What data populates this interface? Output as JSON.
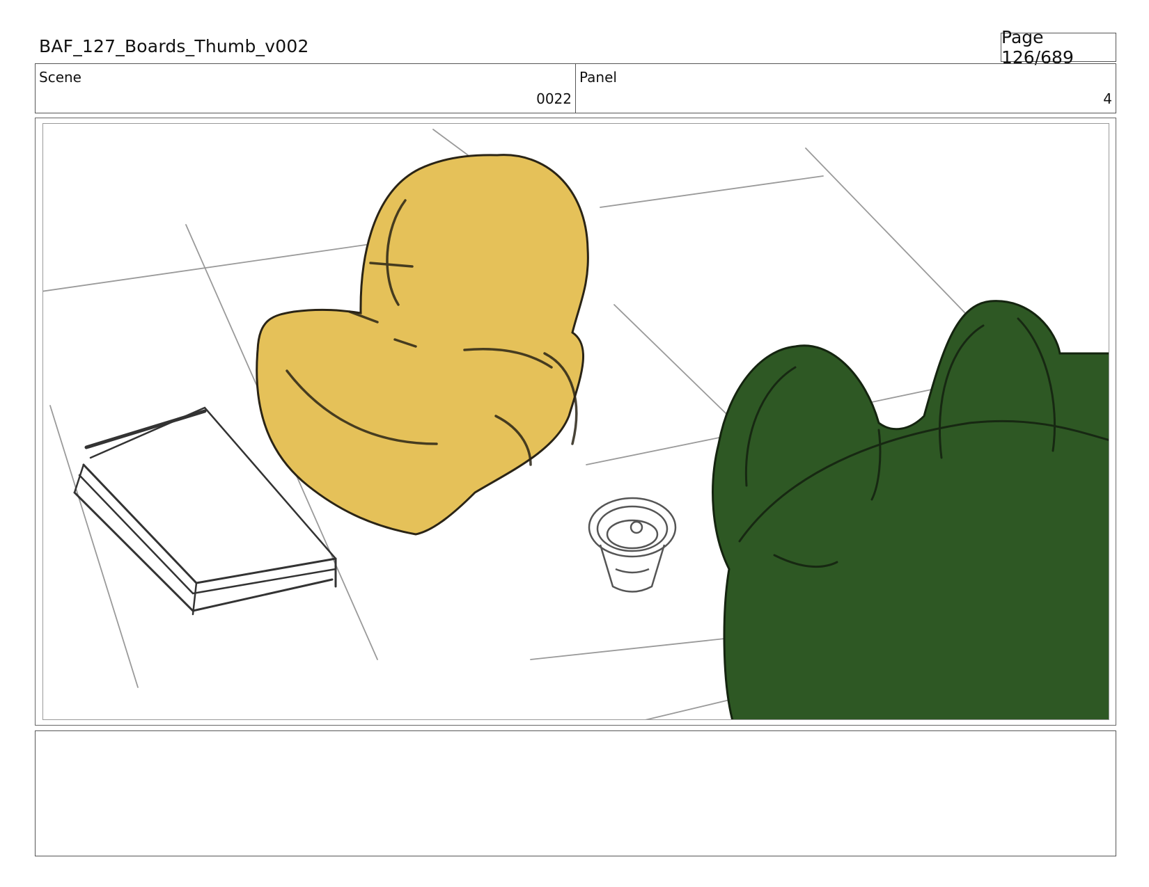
{
  "document": {
    "title": "BAF_127_Boards_Thumb_v002",
    "page_label": "Page 126/689"
  },
  "scene": {
    "label": "Scene",
    "value": "0022"
  },
  "panel": {
    "label": "Panel",
    "value": "4"
  },
  "drawing": {
    "fill_colors": {
      "yellow_character": "#e5c159",
      "green_character": "#2e5824",
      "sketch_line": "#333333"
    }
  },
  "notes": {
    "text": ""
  }
}
